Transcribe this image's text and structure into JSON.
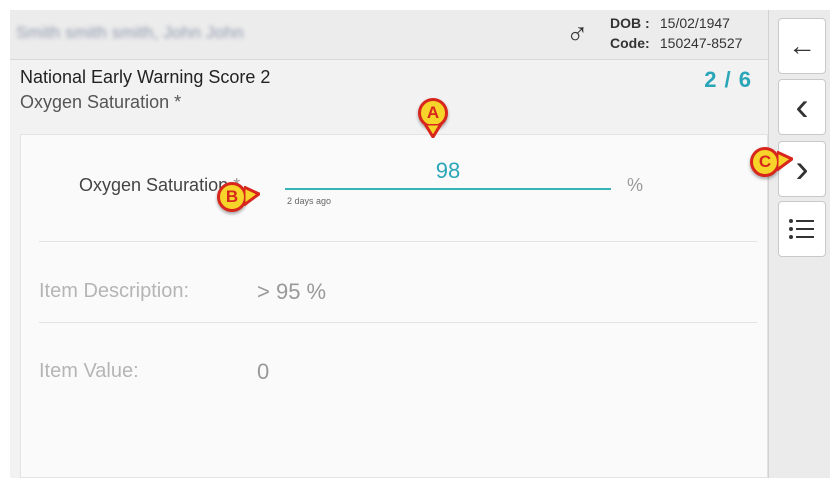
{
  "patient": {
    "name": "Smith smith smith, John John",
    "gender_symbol": "♂",
    "dob_label": "DOB :",
    "dob_value": "15/02/1947",
    "code_label": "Code:",
    "code_value": "150247-8527"
  },
  "form": {
    "title": "National Early Warning Score 2",
    "subtitle": "Oxygen Saturation *",
    "progress": "2 / 6"
  },
  "field": {
    "label": "Oxygen Saturation",
    "required_mark": " *",
    "value": "98",
    "hint": "2 days ago",
    "unit": "%"
  },
  "info": {
    "description_label": "Item Description:",
    "description_value": "> 95 %",
    "value_label": "Item Value:",
    "value_value": "0"
  },
  "sidebar": {
    "back_icon": "←",
    "prev_icon": "‹",
    "next_icon": "›",
    "list_icon": "≡"
  },
  "markers": {
    "a": "A",
    "b": "B",
    "c": "C"
  },
  "colors": {
    "accent": "#2aa6b8",
    "marker_fill": "#f7d42a",
    "marker_border": "#d8261d"
  }
}
